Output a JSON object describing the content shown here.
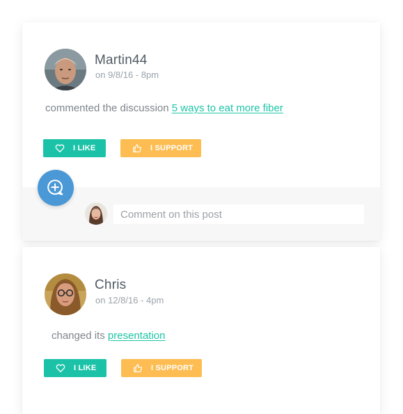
{
  "posts": [
    {
      "user": "Martin44",
      "time": "on 9/8/16 - 8pm",
      "activity_text": "commented the discussion",
      "activity_link": "5 ways to eat more fiber",
      "like_label": "I LIKE",
      "support_label": "I SUPPORT",
      "avatar_icon": "elderly-man-avatar"
    },
    {
      "user": "Chris",
      "time": "on 12/8/16 - 4pm",
      "activity_text": "changed its",
      "activity_link": "presentation",
      "like_label": "I LIKE",
      "support_label": "I SUPPORT",
      "avatar_icon": "woman-glasses-avatar"
    }
  ],
  "comment": {
    "placeholder": "Comment on this post",
    "avatar_icon": "current-user-avatar"
  },
  "fab": {
    "icon": "add-comment-icon"
  },
  "colors": {
    "like": "#1cc2a8",
    "support": "#fdbd52",
    "link": "#1dc4a6",
    "fab": "#4a98d5"
  }
}
